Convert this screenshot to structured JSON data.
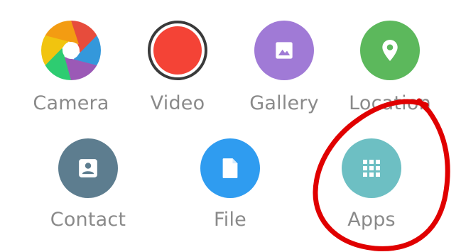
{
  "attachments": [
    {
      "id": "camera",
      "label": "Camera",
      "icon": "camera-aperture-icon"
    },
    {
      "id": "video",
      "label": "Video",
      "icon": "record-icon",
      "color": "#f44336"
    },
    {
      "id": "gallery",
      "label": "Gallery",
      "icon": "image-icon",
      "color": "#a07ad6"
    },
    {
      "id": "location",
      "label": "Location",
      "icon": "map-pin-icon",
      "color": "#5cb85c"
    },
    {
      "id": "contact",
      "label": "Contact",
      "icon": "person-icon",
      "color": "#5d7d8f"
    },
    {
      "id": "file",
      "label": "File",
      "icon": "document-icon",
      "color": "#2f9cf0"
    },
    {
      "id": "apps",
      "label": "Apps",
      "icon": "grid-icon",
      "color": "#6dbfc3"
    }
  ],
  "annotation": {
    "shape": "hand-drawn-circle",
    "color": "#e00000",
    "target": "apps"
  },
  "camera_colors": [
    "#e74c3c",
    "#3498db",
    "#9b59b6",
    "#2ecc71",
    "#f1c40f",
    "#f39c12"
  ]
}
